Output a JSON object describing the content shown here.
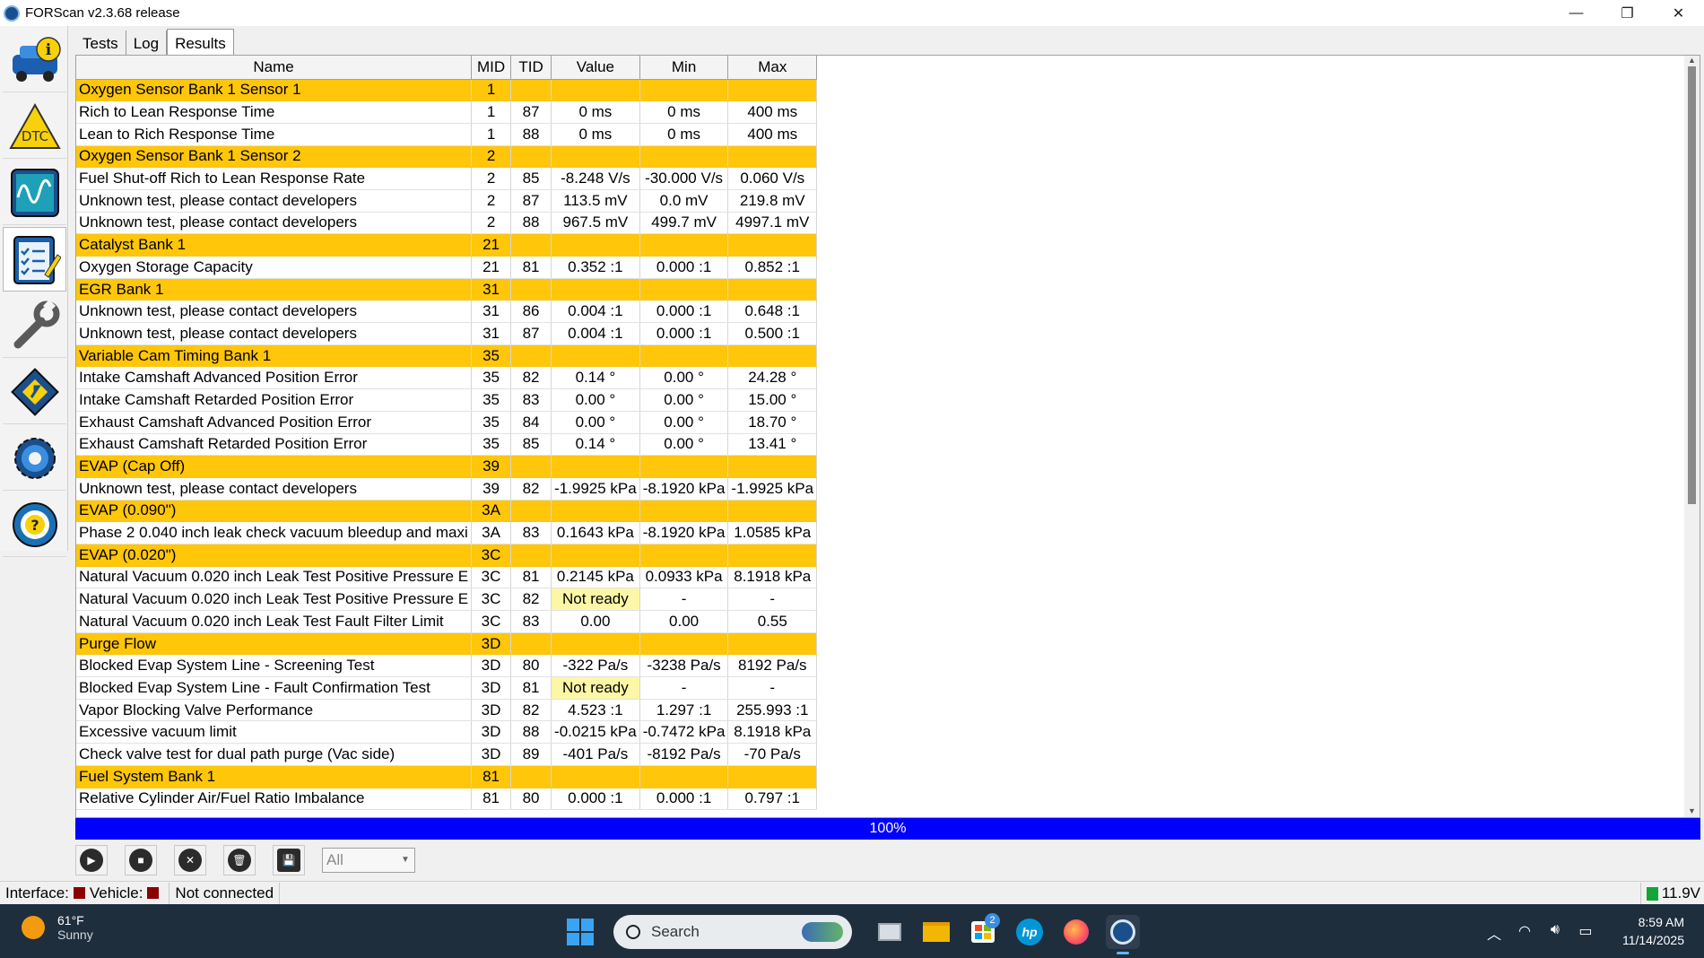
{
  "window": {
    "title": "FORScan v2.3.68 release"
  },
  "window_controls": {
    "minimize": "—",
    "restore": "❐",
    "close": "✕"
  },
  "toolbar": [
    {
      "name": "vehicle-info",
      "icon": "car-info-icon"
    },
    {
      "name": "dtc",
      "icon": "dtc-warning-icon",
      "label": "DTC"
    },
    {
      "name": "oscilloscope",
      "icon": "waveform-icon"
    },
    {
      "name": "tests",
      "icon": "checklist-icon"
    },
    {
      "name": "service",
      "icon": "wrench-icon"
    },
    {
      "name": "configuration",
      "icon": "chip-icon"
    },
    {
      "name": "settings",
      "icon": "gear-icon"
    },
    {
      "name": "help",
      "icon": "help-wheel-icon",
      "label": "?"
    }
  ],
  "tabs": [
    {
      "label": "Tests",
      "selected": false
    },
    {
      "label": "Log",
      "selected": false
    },
    {
      "label": "Results",
      "selected": true
    }
  ],
  "table": {
    "columns": [
      "Name",
      "MID",
      "TID",
      "Value",
      "Min",
      "Max"
    ],
    "rows": [
      {
        "group": true,
        "name": "Oxygen Sensor Bank 1 Sensor 1",
        "mid": "1"
      },
      {
        "name": "Rich to Lean Response Time",
        "mid": "1",
        "tid": "87",
        "value": "0 ms",
        "min": "0 ms",
        "max": "400 ms"
      },
      {
        "name": "Lean to Rich Response Time",
        "mid": "1",
        "tid": "88",
        "value": "0 ms",
        "min": "0 ms",
        "max": "400 ms"
      },
      {
        "group": true,
        "name": "Oxygen Sensor Bank 1 Sensor 2",
        "mid": "2"
      },
      {
        "name": "Fuel Shut-off Rich to Lean Response Rate",
        "mid": "2",
        "tid": "85",
        "value": "-8.248 V/s",
        "min": "-30.000 V/s",
        "max": "0.060 V/s"
      },
      {
        "name": "Unknown test, please contact developers",
        "mid": "2",
        "tid": "87",
        "value": "113.5 mV",
        "min": "0.0 mV",
        "max": "219.8 mV"
      },
      {
        "name": "Unknown test, please contact developers",
        "mid": "2",
        "tid": "88",
        "value": "967.5 mV",
        "min": "499.7 mV",
        "max": "4997.1 mV"
      },
      {
        "group": true,
        "name": "Catalyst Bank 1",
        "mid": "21"
      },
      {
        "name": "Oxygen Storage Capacity",
        "mid": "21",
        "tid": "81",
        "value": "0.352 :1",
        "min": "0.000 :1",
        "max": "0.852 :1"
      },
      {
        "group": true,
        "name": "EGR Bank 1",
        "mid": "31"
      },
      {
        "name": "Unknown test, please contact developers",
        "mid": "31",
        "tid": "86",
        "value": "0.004 :1",
        "min": "0.000 :1",
        "max": "0.648 :1"
      },
      {
        "name": "Unknown test, please contact developers",
        "mid": "31",
        "tid": "87",
        "value": "0.004 :1",
        "min": "0.000 :1",
        "max": "0.500 :1"
      },
      {
        "group": true,
        "name": "Variable Cam Timing Bank 1",
        "mid": "35"
      },
      {
        "name": "Intake Camshaft Advanced Position Error",
        "mid": "35",
        "tid": "82",
        "value": "0.14 °",
        "min": "0.00 °",
        "max": "24.28 °"
      },
      {
        "name": "Intake Camshaft Retarded Position Error",
        "mid": "35",
        "tid": "83",
        "value": "0.00 °",
        "min": "0.00 °",
        "max": "15.00 °"
      },
      {
        "name": "Exhaust Camshaft Advanced Position Error",
        "mid": "35",
        "tid": "84",
        "value": "0.00 °",
        "min": "0.00 °",
        "max": "18.70 °"
      },
      {
        "name": "Exhaust Camshaft Retarded Position Error",
        "mid": "35",
        "tid": "85",
        "value": "0.14 °",
        "min": "0.00 °",
        "max": "13.41 °"
      },
      {
        "group": true,
        "name": "EVAP (Cap Off)",
        "mid": "39"
      },
      {
        "name": "Unknown test, please contact developers",
        "mid": "39",
        "tid": "82",
        "value": "-1.9925 kPa",
        "min": "-8.1920 kPa",
        "max": "-1.9925 kPa"
      },
      {
        "group": true,
        "name": "EVAP (0.090\")",
        "mid": "3A"
      },
      {
        "name": "Phase 2 0.040 inch leak check vacuum bleedup and maxi",
        "mid": "3A",
        "tid": "83",
        "value": "0.1643 kPa",
        "min": "-8.1920 kPa",
        "max": "1.0585 kPa"
      },
      {
        "group": true,
        "name": "EVAP (0.020\")",
        "mid": "3C"
      },
      {
        "name": "Natural Vacuum 0.020 inch Leak Test Positive Pressure E",
        "mid": "3C",
        "tid": "81",
        "value": "0.2145 kPa",
        "min": "0.0933 kPa",
        "max": "8.1918 kPa"
      },
      {
        "name": "Natural Vacuum 0.020 inch Leak Test Positive Pressure E",
        "mid": "3C",
        "tid": "82",
        "value": "Not ready",
        "min": "-",
        "max": "-",
        "notready": true
      },
      {
        "name": "Natural Vacuum 0.020 inch Leak Test Fault Filter Limit",
        "mid": "3C",
        "tid": "83",
        "value": "0.00",
        "min": "0.00",
        "max": "0.55"
      },
      {
        "group": true,
        "name": "Purge Flow",
        "mid": "3D"
      },
      {
        "name": "Blocked Evap System Line - Screening Test",
        "mid": "3D",
        "tid": "80",
        "value": "-322 Pa/s",
        "min": "-3238 Pa/s",
        "max": "8192 Pa/s"
      },
      {
        "name": "Blocked Evap System Line - Fault Confirmation Test",
        "mid": "3D",
        "tid": "81",
        "value": "Not ready",
        "min": "-",
        "max": "-",
        "notready": true
      },
      {
        "name": "Vapor Blocking Valve Performance",
        "mid": "3D",
        "tid": "82",
        "value": "4.523 :1",
        "min": "1.297 :1",
        "max": "255.993 :1"
      },
      {
        "name": "Excessive vacuum limit",
        "mid": "3D",
        "tid": "88",
        "value": "-0.0215 kPa",
        "min": "-0.7472 kPa",
        "max": "8.1918 kPa"
      },
      {
        "name": "Check valve test for dual path purge (Vac side)",
        "mid": "3D",
        "tid": "89",
        "value": "-401 Pa/s",
        "min": "-8192 Pa/s",
        "max": "-70 Pa/s"
      },
      {
        "group": true,
        "name": "Fuel System Bank 1",
        "mid": "81"
      },
      {
        "name": "Relative Cylinder Air/Fuel Ratio Imbalance",
        "mid": "81",
        "tid": "80",
        "value": "0.000 :1",
        "min": "0.000 :1",
        "max": "0.797 :1"
      }
    ]
  },
  "progress": {
    "label": "100%",
    "fraction": 1.0
  },
  "controls": {
    "buttons": [
      {
        "name": "start-button",
        "icon": "play-icon",
        "glyph": "▶"
      },
      {
        "name": "stop-button",
        "icon": "stop-icon",
        "glyph": "■"
      },
      {
        "name": "clear-button",
        "icon": "clear-icon",
        "glyph": "✕"
      },
      {
        "name": "delete-button",
        "icon": "trash-icon",
        "glyph": "🗑"
      },
      {
        "name": "save-button",
        "icon": "save-icon",
        "glyph": "💾"
      }
    ],
    "filter_value": "All"
  },
  "status": {
    "interface_label": "Interface:",
    "vehicle_label": "Vehicle:",
    "connection": "Not connected",
    "voltage": "11.9V",
    "indicator_colors": {
      "interface": "#8b0000",
      "vehicle": "#8b0000",
      "battery": "#13a537"
    }
  },
  "taskbar": {
    "weather_temp": "61°F",
    "weather_desc": "Sunny",
    "search_placeholder": "Search",
    "store_badge": "2",
    "time": "8:59 AM",
    "date": "11/14/2025"
  },
  "colors": {
    "group_row": "#ffc60a",
    "not_ready": "#fbf7a6",
    "progress": "#0000ff"
  }
}
